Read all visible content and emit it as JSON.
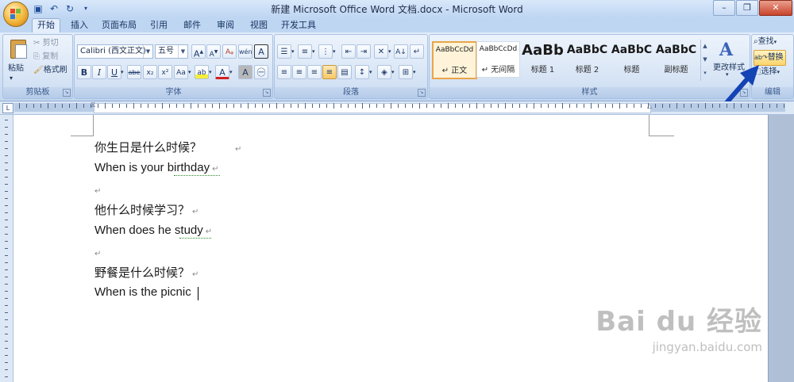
{
  "window": {
    "title": "新建 Microsoft Office Word 文档.docx - Microsoft Word",
    "controls": [
      "minimize",
      "restore",
      "close"
    ]
  },
  "quick_access": {
    "save_icon": "save-icon",
    "undo_icon": "undo-icon",
    "redo_icon": "redo-icon"
  },
  "tabs": [
    "开始",
    "插入",
    "页面布局",
    "引用",
    "邮件",
    "审阅",
    "视图",
    "开发工具"
  ],
  "active_tab": "开始",
  "ribbon": {
    "clipboard": {
      "label": "剪贴板",
      "paste": "粘贴",
      "cut": "剪切",
      "copy": "复制",
      "format_painter": "格式刷"
    },
    "font": {
      "label": "字体",
      "font_name": "Calibri (西文正文)",
      "font_size": "五号",
      "bold": "B",
      "italic": "I",
      "underline": "U",
      "strikethrough": "abe",
      "subscript": "x₂",
      "superscript": "x²",
      "change_case": "Aa",
      "grow": "A",
      "shrink": "A",
      "phonetic": "wén",
      "char_border": "A",
      "highlight": "ab",
      "font_color": "A",
      "char_shade": "A",
      "enclose": "㊀"
    },
    "paragraph": {
      "label": "段落"
    },
    "styles": {
      "label": "样式",
      "items": [
        {
          "sample": "AaBbCcDd",
          "name": "↵ 正文",
          "selected": true
        },
        {
          "sample": "AaBbCcDd",
          "name": "↵ 无间隔",
          "selected": false
        },
        {
          "sample": "AaBb",
          "name": "标题 1",
          "selected": false
        },
        {
          "sample": "AaBbC",
          "name": "标题 2",
          "selected": false
        },
        {
          "sample": "AaBbC",
          "name": "标题",
          "selected": false
        },
        {
          "sample": "AaBbC",
          "name": "副标题",
          "selected": false
        }
      ],
      "change_styles": "更改样式"
    },
    "editing": {
      "label": "编辑",
      "find": "查找",
      "replace": "替换",
      "select": "选择"
    }
  },
  "document": {
    "lines": [
      {
        "text": "你生日是什么时候？",
        "lang": "zh",
        "mark": "↵"
      },
      {
        "text": "When is your birthday",
        "lang": "en",
        "mark": "↵"
      },
      {
        "text": "",
        "lang": "en",
        "mark": "↵"
      },
      {
        "text": "他什么时候学习？",
        "lang": "zh",
        "mark": "↵"
      },
      {
        "text": "When does he study",
        "lang": "en",
        "mark": "↵"
      },
      {
        "text": "",
        "lang": "en",
        "mark": "↵"
      },
      {
        "text": "野餐是什么时候？",
        "lang": "zh",
        "mark": "↵"
      },
      {
        "text": "When is the picnic",
        "lang": "en",
        "mark": ""
      }
    ]
  },
  "watermark": {
    "brand": "Bai du 经验",
    "url": "jingyan.baidu.com"
  },
  "colors": {
    "ribbon_bg": "#cfdff3",
    "selected_style": "#e9a54a",
    "annotation_arrow": "#1443b5"
  }
}
